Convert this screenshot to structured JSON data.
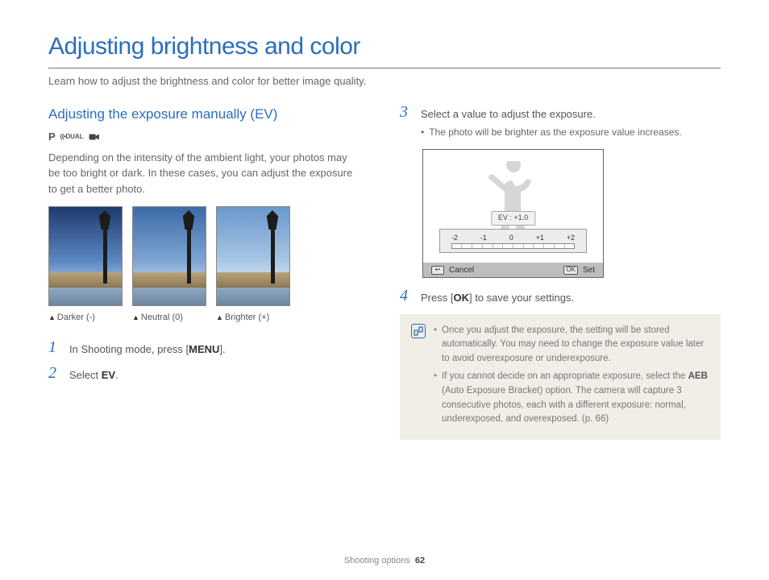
{
  "page": {
    "title": "Adjusting brightness and color",
    "subtitle": "Learn how to adjust the brightness and color for better image quality."
  },
  "section": {
    "title": "Adjusting the exposure manually (EV)",
    "modes": {
      "p": "P",
      "dual": "DUAL"
    },
    "intro": "Depending on the intensity of the ambient light, your photos may be too bright or dark. In these cases, you can adjust the exposure to get a better photo.",
    "captions": {
      "darker": "Darker (-)",
      "neutral": "Neutral (0)",
      "brighter": "Brighter (+)"
    }
  },
  "steps": {
    "s1_pre": "In Shooting mode, press [",
    "s1_btn": "MENU",
    "s1_post": "].",
    "s2_pre": "Select ",
    "s2_kw": "EV",
    "s2_post": ".",
    "s3": "Select a value to adjust the exposure.",
    "s3_sub": "The photo will be brighter as the exposure value increases.",
    "s4_pre": "Press [",
    "s4_btn": "OK",
    "s4_post": "] to save your settings."
  },
  "screen": {
    "ev_label": "EV : +1.0",
    "scale": {
      "n2": "-2",
      "n1": "-1",
      "z": "0",
      "p1": "+1",
      "p2": "+2"
    },
    "cancel": "Cancel",
    "ok": "OK",
    "set": "Set",
    "back": "↩"
  },
  "note": {
    "li1": "Once you adjust the exposure, the setting will be stored automatically. You may need to change the exposure value later to avoid overexposure or underexposure.",
    "li2_pre": "If you cannot decide on an appropriate exposure, select the ",
    "li2_kw": "AEB",
    "li2_post": " (Auto Exposure Bracket) option. The camera will capture 3 consecutive photos, each with a different exposure: normal, underexposed, and overexposed. (p. 66)"
  },
  "footer": {
    "section": "Shooting options",
    "page": "62"
  }
}
